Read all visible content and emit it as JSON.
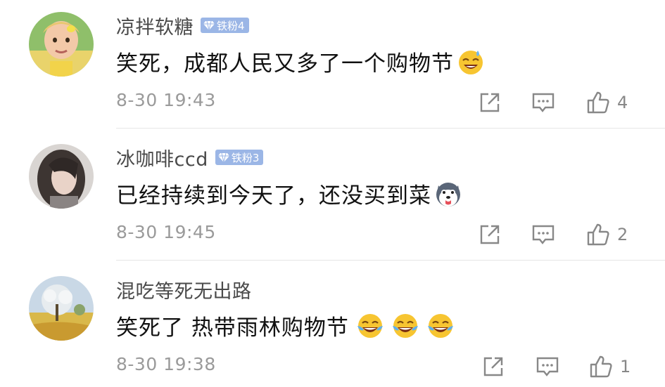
{
  "comments": [
    {
      "username": "凉拌软糖",
      "badge": "铁粉4",
      "text": "笑死，成都人民又多了一个购物节",
      "emojis": [
        "laughing-sweat-emoji"
      ],
      "timestamp": "8-30 19:43",
      "likes": "4"
    },
    {
      "username": "冰咖啡ccd",
      "badge": "铁粉3",
      "text": "已经持续到今天了，还没买到菜",
      "emojis": [
        "husky-emoji"
      ],
      "timestamp": "8-30 19:45",
      "likes": "2"
    },
    {
      "username": "混吃等死无出路",
      "badge": "",
      "text": "笑死了 热带雨林购物节",
      "emojis": [
        "tears-of-joy-emoji",
        "tears-of-joy-emoji",
        "tears-of-joy-emoji"
      ],
      "timestamp": "8-30 19:38",
      "likes": "1"
    }
  ],
  "icons": {
    "share": "share-icon",
    "comment": "comment-icon",
    "like": "thumbs-up-icon",
    "badge": "diamond-icon"
  },
  "colors": {
    "badge_bg": "#9bb6e6",
    "username": "#4a4a4a",
    "meta": "#9a9a9a"
  }
}
